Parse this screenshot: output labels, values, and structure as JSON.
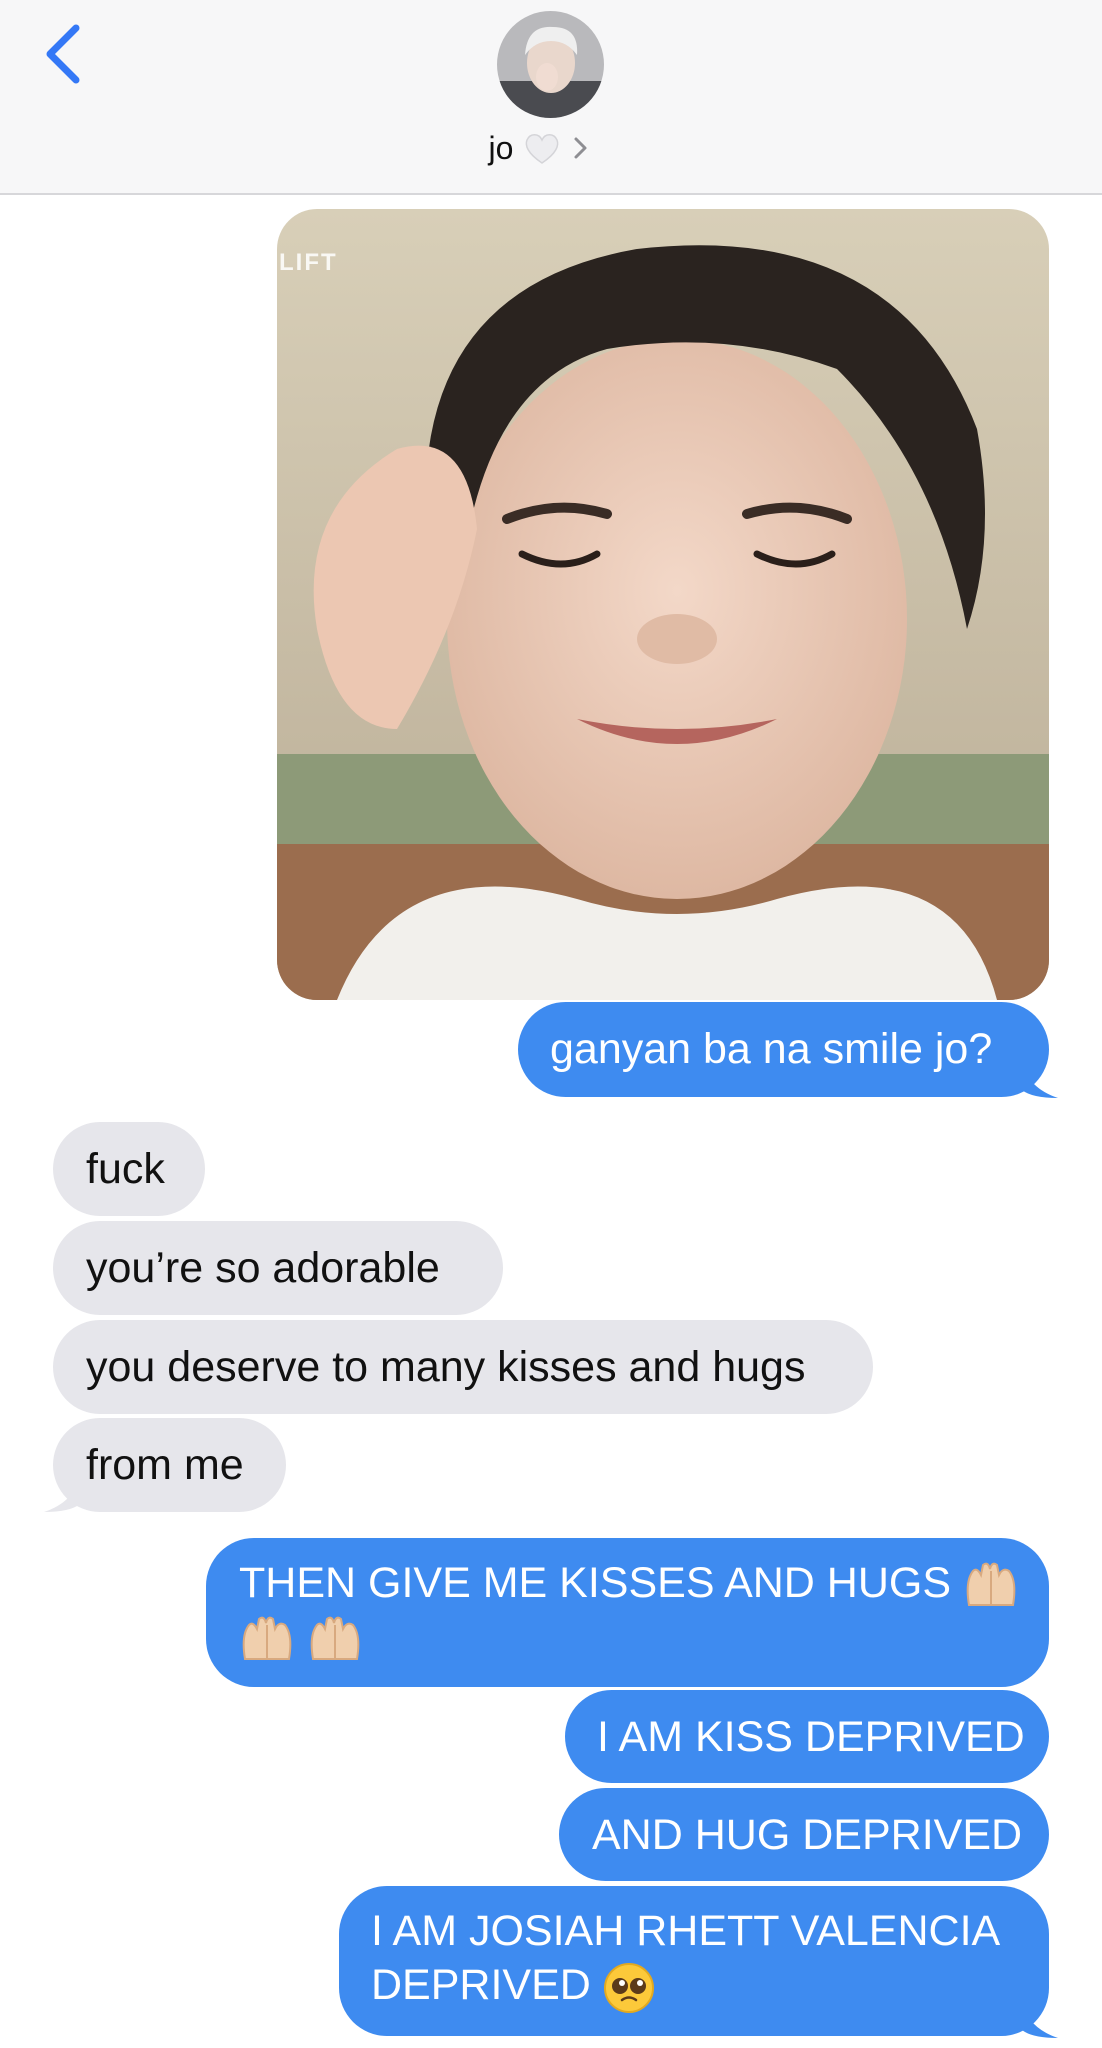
{
  "header": {
    "contact_name": "jo",
    "icons": {
      "back": "chevron-left-icon",
      "heart": "white-heart-icon",
      "details": "chevron-right-icon"
    }
  },
  "photo_message": {
    "watermark": "LIFT"
  },
  "messages": [
    {
      "from": "me",
      "text": "ganyan ba na smile jo?"
    },
    {
      "from": "them",
      "text": "fuck"
    },
    {
      "from": "them",
      "text": "you’re so adorable"
    },
    {
      "from": "them",
      "text": "you deserve to many kisses and hugs"
    },
    {
      "from": "them",
      "text": "from me"
    },
    {
      "from": "me",
      "text": "THEN GIVE ME KISSES AND HUGS",
      "emoji": "raising-hands-emoji ×3"
    },
    {
      "from": "me",
      "text": "I AM KISS DEPRIVED"
    },
    {
      "from": "me",
      "text": "AND HUG DEPRIVED"
    },
    {
      "from": "me",
      "text_line1": "I AM JOSIAH RHETT VALENCIA",
      "text_line2": "DEPRIVED",
      "emoji": "pleading-face-emoji"
    }
  ],
  "colors": {
    "sent_bubble": "#3e8bf0",
    "received_bubble": "#e6e6eb",
    "accent": "#3478f6"
  }
}
